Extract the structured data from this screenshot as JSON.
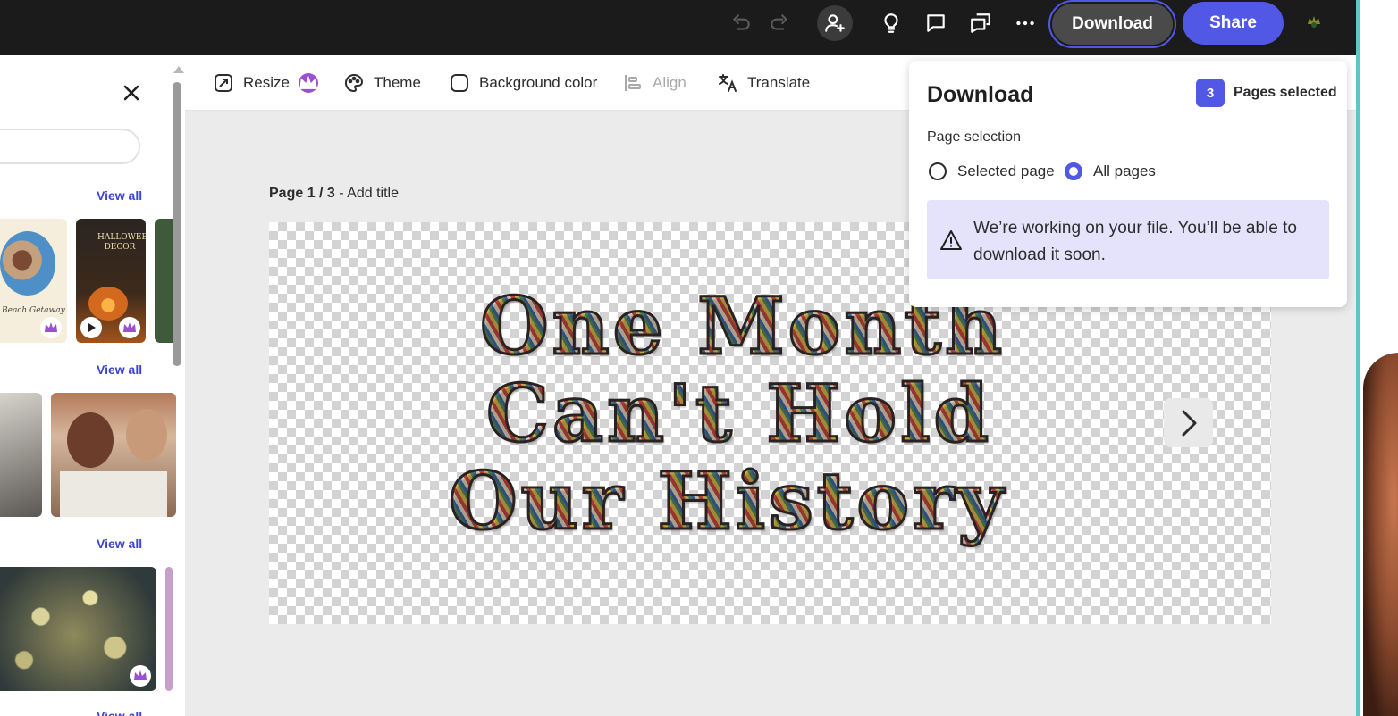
{
  "topbar": {
    "download_label": "Download",
    "share_label": "Share",
    "icons": [
      "undo-icon",
      "redo-icon",
      "invite-icon",
      "lightbulb-icon",
      "comment-icon",
      "review-icon",
      "more-icon"
    ]
  },
  "left_panel": {
    "view_all": [
      "View all",
      "View all",
      "View all",
      "View all"
    ],
    "thumb_text": {
      "beach": "Beach Getaway",
      "halloween": "HALLOWEEN DECOR"
    }
  },
  "toolbar": {
    "resize": "Resize",
    "theme": "Theme",
    "background_color": "Background color",
    "align": "Align",
    "translate": "Translate"
  },
  "canvas": {
    "page_num": "Page 1 / 3",
    "page_title": " - Add title",
    "lines": [
      "One Month",
      "Can't Hold",
      "Our History"
    ]
  },
  "download_panel": {
    "title": "Download",
    "pages_count": "3",
    "pages_selected": "Pages selected",
    "page_selection_label": "Page selection",
    "option_selected": "Selected page",
    "option_all": "All pages",
    "selected_option": "All pages",
    "notice": "We’re working on your file. You’ll be able to download it soon."
  },
  "colors": {
    "accent": "#5158e6",
    "topbar_bg": "#1b1b1b",
    "notice_bg": "#e4e3fb"
  }
}
